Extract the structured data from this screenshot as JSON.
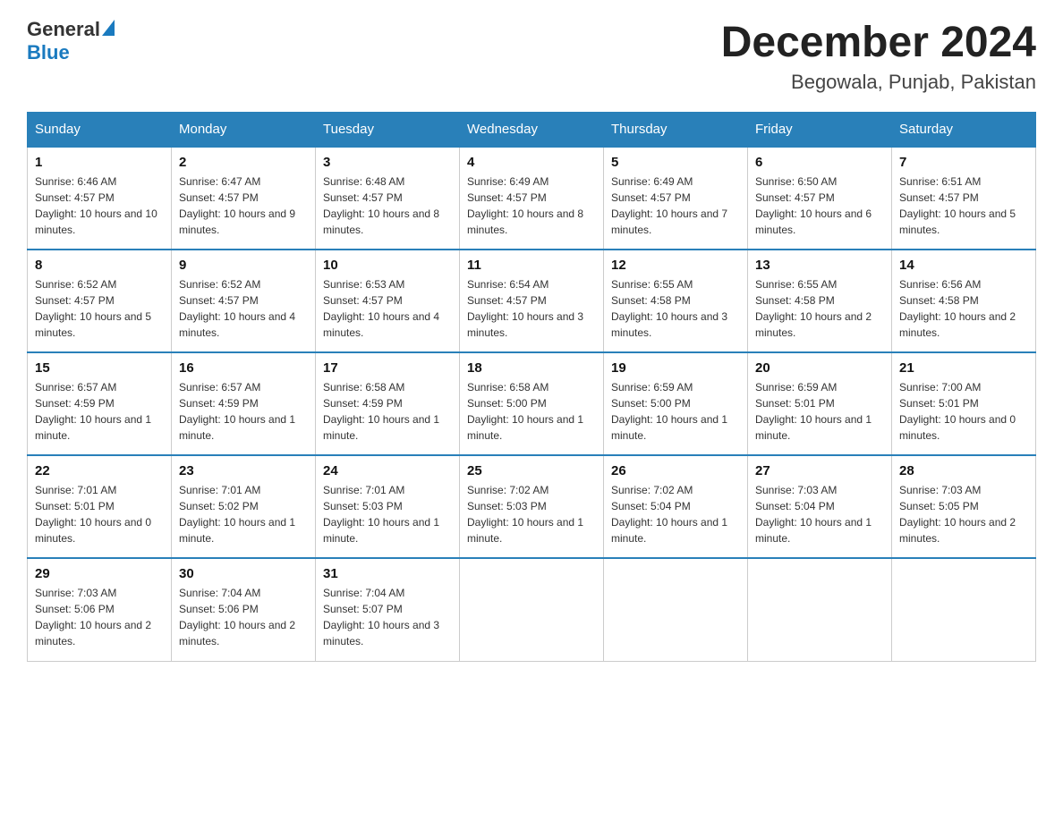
{
  "header": {
    "logo_general": "General",
    "logo_blue": "Blue",
    "month_title": "December 2024",
    "location": "Begowala, Punjab, Pakistan"
  },
  "days_of_week": [
    "Sunday",
    "Monday",
    "Tuesday",
    "Wednesday",
    "Thursday",
    "Friday",
    "Saturday"
  ],
  "weeks": [
    [
      {
        "day": "1",
        "sunrise": "6:46 AM",
        "sunset": "4:57 PM",
        "daylight": "10 hours and 10 minutes."
      },
      {
        "day": "2",
        "sunrise": "6:47 AM",
        "sunset": "4:57 PM",
        "daylight": "10 hours and 9 minutes."
      },
      {
        "day": "3",
        "sunrise": "6:48 AM",
        "sunset": "4:57 PM",
        "daylight": "10 hours and 8 minutes."
      },
      {
        "day": "4",
        "sunrise": "6:49 AM",
        "sunset": "4:57 PM",
        "daylight": "10 hours and 8 minutes."
      },
      {
        "day": "5",
        "sunrise": "6:49 AM",
        "sunset": "4:57 PM",
        "daylight": "10 hours and 7 minutes."
      },
      {
        "day": "6",
        "sunrise": "6:50 AM",
        "sunset": "4:57 PM",
        "daylight": "10 hours and 6 minutes."
      },
      {
        "day": "7",
        "sunrise": "6:51 AM",
        "sunset": "4:57 PM",
        "daylight": "10 hours and 5 minutes."
      }
    ],
    [
      {
        "day": "8",
        "sunrise": "6:52 AM",
        "sunset": "4:57 PM",
        "daylight": "10 hours and 5 minutes."
      },
      {
        "day": "9",
        "sunrise": "6:52 AM",
        "sunset": "4:57 PM",
        "daylight": "10 hours and 4 minutes."
      },
      {
        "day": "10",
        "sunrise": "6:53 AM",
        "sunset": "4:57 PM",
        "daylight": "10 hours and 4 minutes."
      },
      {
        "day": "11",
        "sunrise": "6:54 AM",
        "sunset": "4:57 PM",
        "daylight": "10 hours and 3 minutes."
      },
      {
        "day": "12",
        "sunrise": "6:55 AM",
        "sunset": "4:58 PM",
        "daylight": "10 hours and 3 minutes."
      },
      {
        "day": "13",
        "sunrise": "6:55 AM",
        "sunset": "4:58 PM",
        "daylight": "10 hours and 2 minutes."
      },
      {
        "day": "14",
        "sunrise": "6:56 AM",
        "sunset": "4:58 PM",
        "daylight": "10 hours and 2 minutes."
      }
    ],
    [
      {
        "day": "15",
        "sunrise": "6:57 AM",
        "sunset": "4:59 PM",
        "daylight": "10 hours and 1 minute."
      },
      {
        "day": "16",
        "sunrise": "6:57 AM",
        "sunset": "4:59 PM",
        "daylight": "10 hours and 1 minute."
      },
      {
        "day": "17",
        "sunrise": "6:58 AM",
        "sunset": "4:59 PM",
        "daylight": "10 hours and 1 minute."
      },
      {
        "day": "18",
        "sunrise": "6:58 AM",
        "sunset": "5:00 PM",
        "daylight": "10 hours and 1 minute."
      },
      {
        "day": "19",
        "sunrise": "6:59 AM",
        "sunset": "5:00 PM",
        "daylight": "10 hours and 1 minute."
      },
      {
        "day": "20",
        "sunrise": "6:59 AM",
        "sunset": "5:01 PM",
        "daylight": "10 hours and 1 minute."
      },
      {
        "day": "21",
        "sunrise": "7:00 AM",
        "sunset": "5:01 PM",
        "daylight": "10 hours and 0 minutes."
      }
    ],
    [
      {
        "day": "22",
        "sunrise": "7:01 AM",
        "sunset": "5:01 PM",
        "daylight": "10 hours and 0 minutes."
      },
      {
        "day": "23",
        "sunrise": "7:01 AM",
        "sunset": "5:02 PM",
        "daylight": "10 hours and 1 minute."
      },
      {
        "day": "24",
        "sunrise": "7:01 AM",
        "sunset": "5:03 PM",
        "daylight": "10 hours and 1 minute."
      },
      {
        "day": "25",
        "sunrise": "7:02 AM",
        "sunset": "5:03 PM",
        "daylight": "10 hours and 1 minute."
      },
      {
        "day": "26",
        "sunrise": "7:02 AM",
        "sunset": "5:04 PM",
        "daylight": "10 hours and 1 minute."
      },
      {
        "day": "27",
        "sunrise": "7:03 AM",
        "sunset": "5:04 PM",
        "daylight": "10 hours and 1 minute."
      },
      {
        "day": "28",
        "sunrise": "7:03 AM",
        "sunset": "5:05 PM",
        "daylight": "10 hours and 2 minutes."
      }
    ],
    [
      {
        "day": "29",
        "sunrise": "7:03 AM",
        "sunset": "5:06 PM",
        "daylight": "10 hours and 2 minutes."
      },
      {
        "day": "30",
        "sunrise": "7:04 AM",
        "sunset": "5:06 PM",
        "daylight": "10 hours and 2 minutes."
      },
      {
        "day": "31",
        "sunrise": "7:04 AM",
        "sunset": "5:07 PM",
        "daylight": "10 hours and 3 minutes."
      },
      null,
      null,
      null,
      null
    ]
  ]
}
